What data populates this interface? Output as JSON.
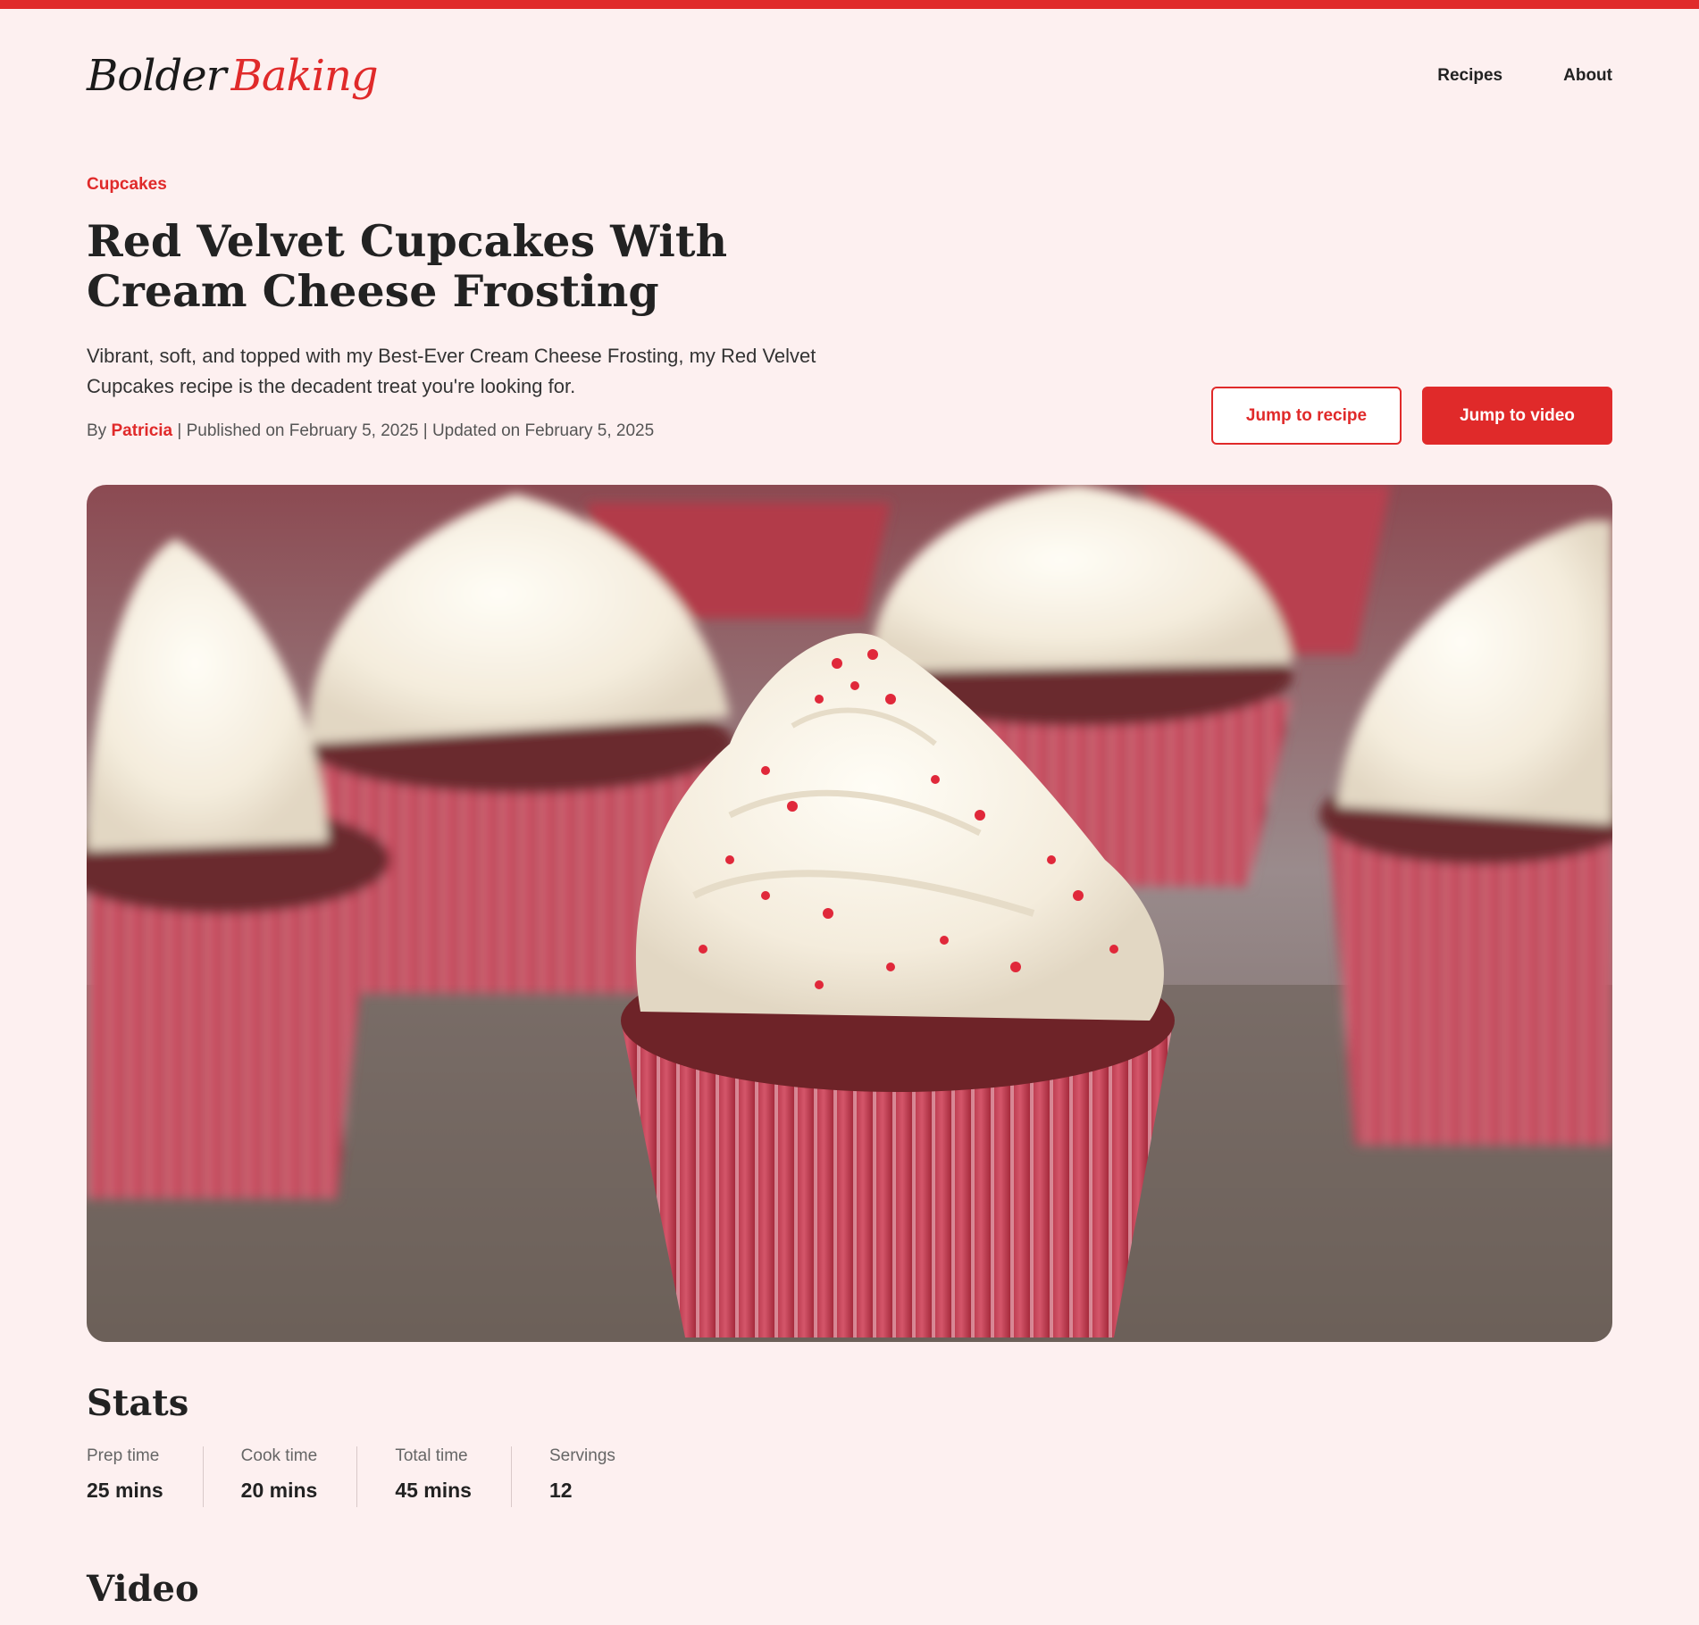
{
  "header": {
    "logo_word1": "Bolder",
    "logo_word2": "Baking",
    "nav": [
      "Recipes",
      "About"
    ]
  },
  "article": {
    "category": "Cupcakes",
    "title": "Red Velvet Cupcakes With Cream Cheese Frosting",
    "description": "Vibrant, soft, and topped with my Best-Ever Cream Cheese Frosting, my Red Velvet Cupcakes recipe is the decadent treat you're looking for.",
    "byline_prefix": "By",
    "author": "Patricia",
    "byline_rest": "| Published on February 5, 2025 | Updated on February 5, 2025"
  },
  "buttons": {
    "jump_recipe": "Jump to recipe",
    "jump_video": "Jump to video"
  },
  "stats": {
    "heading": "Stats",
    "items": [
      {
        "label": "Prep time",
        "value": "25 mins"
      },
      {
        "label": "Cook time",
        "value": "20 mins"
      },
      {
        "label": "Total time",
        "value": "45 mins"
      },
      {
        "label": "Servings",
        "value": "12"
      }
    ]
  },
  "video": {
    "heading": "Video"
  },
  "colors": {
    "accent": "#e02a2a",
    "background": "#fdf0f0"
  }
}
